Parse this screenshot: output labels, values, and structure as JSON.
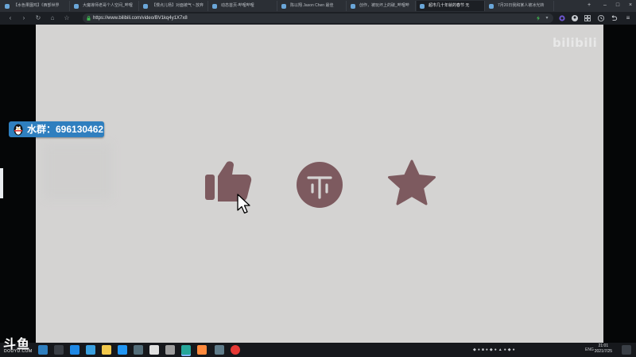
{
  "browser": {
    "tabs": [
      {
        "label": "【水色果園鸡】《西部世界"
      },
      {
        "label": "大魔導师老哥个人空间_哔哩"
      },
      {
        "label": "【慢点儿杨】对面被气丶放弃"
      },
      {
        "label": "动态首页-哔哩哔哩"
      },
      {
        "label": "陈以翔 Jason Chen 最佳"
      },
      {
        "label": "创作，被玩坏上的破_哔哩哔"
      },
      {
        "label": "超市几十年就的春节 无"
      },
      {
        "label": "7月20日我和某人被冰光转"
      }
    ],
    "url": "https://www.bilibili.com/video/BV1kq4y1X7x8",
    "accent": "#2f7fbf"
  },
  "video": {
    "watermark": "bilibili",
    "qq_badge": "水群：696130462",
    "bg_color": "#d4d3d2",
    "icon_color": "#7d5a5f"
  },
  "taskbar": {
    "tray_lang": "ENG",
    "time": "21:01",
    "date": "2021/7/25"
  },
  "overlay": {
    "logo_main": "斗鱼",
    "logo_sub": "DOUYU.COM"
  }
}
